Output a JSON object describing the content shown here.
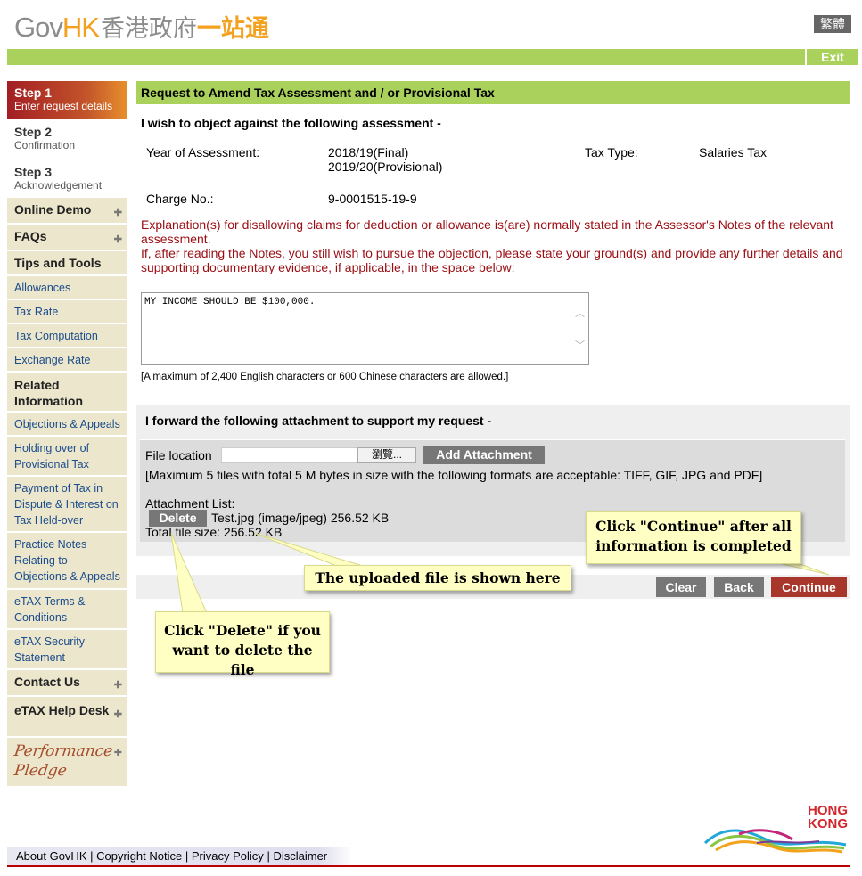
{
  "header": {
    "logo_gov": "Gov",
    "logo_hk": "HK",
    "logo_zh_main": "香港政府",
    "logo_zh_accent": "一站通",
    "lang_button": "繁體",
    "exit_button": "Exit"
  },
  "sidebar": {
    "steps": [
      {
        "title": "Step 1",
        "subtitle": "Enter request details"
      },
      {
        "title": "Step 2",
        "subtitle": "Confirmation"
      },
      {
        "title": "Step 3",
        "subtitle": "Acknowledgement"
      }
    ],
    "online_demo": "Online Demo",
    "faqs": "FAQs",
    "tips_tools": "Tips and Tools",
    "allowances": "Allowances",
    "tax_rate": "Tax Rate",
    "tax_computation": "Tax Computation",
    "exchange_rate": "Exchange Rate",
    "related_information": "Related Information",
    "objections_appeals": "Objections & Appeals",
    "holding_over": "Holding over of Provisional Tax",
    "payment_dispute": "Payment of Tax in Dispute & Interest on Tax Held-over",
    "practice_notes": "Practice Notes Relating to Objections & Appeals",
    "etax_terms": "eTAX Terms & Conditions",
    "etax_security": "eTAX Security Statement",
    "contact_us": "Contact Us",
    "etax_help": "eTAX Help Desk",
    "pledge_line1": "Performance",
    "pledge_line2": "Pledge"
  },
  "main": {
    "title": "Request to Amend Tax Assessment and / or Provisional Tax",
    "object_heading": "I wish to object against the following assessment -",
    "year_label": "Year of Assessment:",
    "year_value_1": "2018/19(Final)",
    "year_value_2": "2019/20(Provisional)",
    "tax_type_label": "Tax Type:",
    "tax_type_value": "Salaries Tax",
    "charge_label": "Charge No.:",
    "charge_value": "9-0001515-19-9",
    "explanation_1": "Explanation(s) for disallowing claims for deduction or allowance is(are) normally stated in the Assessor's Notes of the relevant assessment.",
    "explanation_2": "If, after reading the Notes, you still wish to pursue the objection, please state your ground(s) and provide any further details and supporting documentary evidence, if applicable, in the space below:",
    "grounds_text": "MY INCOME SHOULD BE $100,000.",
    "max_note": "[A maximum of 2,400 English characters or 600 Chinese characters are allowed.]",
    "attach_heading": "I forward the following attachment to support my request -",
    "file_location_label": "File location",
    "browse_button": "瀏覽...",
    "add_attachment_button": "Add Attachment",
    "max_files_note": "[Maximum 5 files with total 5 M bytes in size with the following formats are acceptable: TIFF, GIF, JPG and PDF]",
    "attachment_list_label": "Attachment List:",
    "delete_button": "Delete",
    "attached_file": "Test.jpg (image/jpeg) 256.52 KB",
    "total_size": "Total file size: 256.52 KB",
    "clear_button": "Clear",
    "back_button": "Back",
    "continue_button": "Continue"
  },
  "callouts": {
    "continue_hint": "Click \"Continue\" after all information is completed",
    "uploaded_hint": "The uploaded file is shown here",
    "delete_hint": "Click \"Delete\" if you want to delete the file"
  },
  "footer": {
    "about": "About GovHK",
    "copyright": "Copyright Notice",
    "privacy": "Privacy Policy",
    "disclaimer": "Disclaimer",
    "separator": "|",
    "brand_line1": "HONG",
    "brand_line2": "KONG"
  },
  "colors": {
    "brand_green": "#a9d15b",
    "brand_orange": "#f3a11e",
    "continue_red": "#a8362a",
    "notice_red": "#9b0d12",
    "nav_bg": "#ebe6cc",
    "link_blue": "#1b4c8c"
  }
}
